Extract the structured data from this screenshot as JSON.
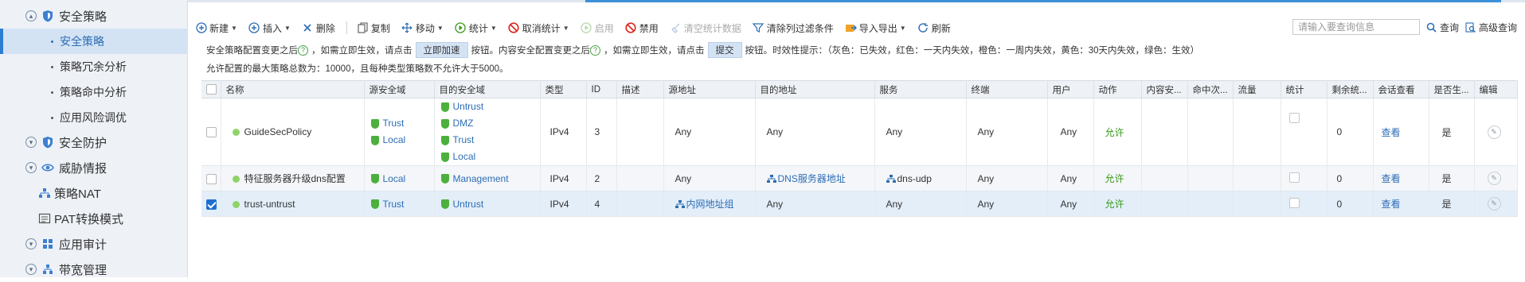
{
  "sidebar": {
    "items": [
      {
        "label": "安全策略",
        "icon": "shield-icon",
        "type": "group"
      },
      {
        "label": "安全策略",
        "type": "sub",
        "active": true
      },
      {
        "label": "策略冗余分析",
        "type": "sub"
      },
      {
        "label": "策略命中分析",
        "type": "sub"
      },
      {
        "label": "应用风险调优",
        "type": "sub"
      },
      {
        "label": "安全防护",
        "icon": "shield-icon",
        "type": "group"
      },
      {
        "label": "威胁情报",
        "icon": "eye-icon",
        "type": "group"
      },
      {
        "label": "策略NAT",
        "icon": "nat-icon",
        "type": "plain"
      },
      {
        "label": "PAT转换模式",
        "icon": "pat-icon",
        "type": "plain"
      },
      {
        "label": "应用审计",
        "icon": "grid-icon",
        "type": "group"
      },
      {
        "label": "带宽管理",
        "icon": "network-icon",
        "type": "group"
      }
    ]
  },
  "toolbar": {
    "new": "新建",
    "insert": "插入",
    "delete": "删除",
    "copy": "复制",
    "move": "移动",
    "stats": "统计",
    "cancel_stats": "取消统计",
    "enable": "启用",
    "disable": "禁用",
    "clear_stats": "清空统计数据",
    "clear_filter": "清除列过滤条件",
    "import_export": "导入导出",
    "refresh": "刷新"
  },
  "search": {
    "placeholder": "请输入要查询信息",
    "query": "查询",
    "advanced": "高级查询"
  },
  "notice": {
    "part1": "安全策略配置变更之后",
    "part2": "，如需立即生效，请点击",
    "accelerate_btn": "立即加速",
    "part3": "按钮。内容安全配置变更之后",
    "part4": "，如需立即生效，请点击",
    "submit_btn": "提交",
    "part5": "按钮。时效性提示：（灰色：已失效，红色：一天内失效，橙色：一周内失效，黄色：30天内失效，绿色：生效）",
    "limit": "允许配置的最大策略总数为：10000，且每种类型策略数不允许大于5000。"
  },
  "table": {
    "headers": [
      "名称",
      "源安全域",
      "目的安全域",
      "类型",
      "ID",
      "描述",
      "源地址",
      "目的地址",
      "服务",
      "终端",
      "用户",
      "动作",
      "内容安...",
      "命中次...",
      "流量",
      "统计",
      "剩余统...",
      "会话查看",
      "是否生...",
      "编辑"
    ],
    "rows": [
      {
        "checked": false,
        "name": "GuideSecPolicy",
        "src_zones": [
          "Trust",
          "Local"
        ],
        "dst_zones": [
          "Untrust",
          "DMZ",
          "Trust",
          "Local"
        ],
        "type": "IPv4",
        "id": "3",
        "desc": "",
        "src_addr": "Any",
        "dst_addr": "Any",
        "service": "Any",
        "terminal": "Any",
        "user": "Any",
        "action": "允许",
        "remaining": "0",
        "session": "查看",
        "effective": "是"
      },
      {
        "checked": false,
        "name": "特征服务器升级dns配置",
        "src_zones": [
          "Local"
        ],
        "dst_zones": [
          "Management"
        ],
        "type": "IPv4",
        "id": "2",
        "desc": "",
        "src_addr": "Any",
        "dst_addr": "DNS服务器地址",
        "service": "dns-udp",
        "terminal": "Any",
        "user": "Any",
        "action": "允许",
        "remaining": "0",
        "session": "查看",
        "effective": "是"
      },
      {
        "checked": true,
        "name": "trust-untrust",
        "src_zones": [
          "Trust"
        ],
        "dst_zones": [
          "Untrust"
        ],
        "type": "IPv4",
        "id": "4",
        "desc": "",
        "src_addr": "内网地址组",
        "dst_addr": "Any",
        "service": "Any",
        "terminal": "Any",
        "user": "Any",
        "action": "允许",
        "remaining": "0",
        "session": "查看",
        "effective": "是"
      }
    ]
  },
  "colors": {
    "accent": "#2d6db5",
    "allow": "#3a9a1a",
    "zone_shield": "#4bb03c",
    "active_sidebar": "#d4e3f4"
  }
}
